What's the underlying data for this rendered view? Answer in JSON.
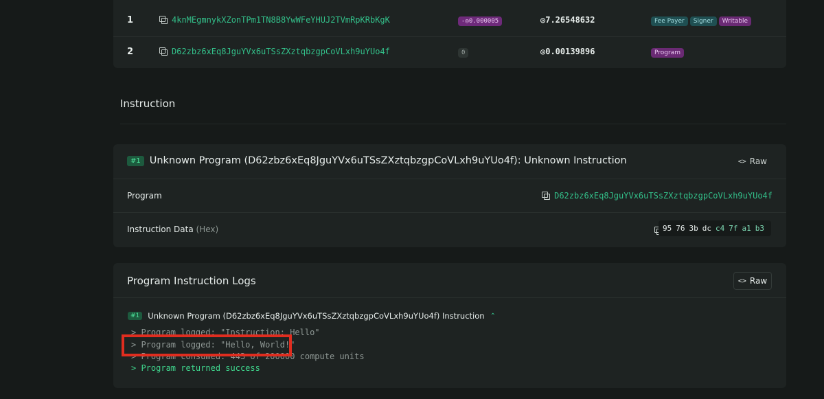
{
  "accounts": [
    {
      "index": "1",
      "address": "4knMEgmnykXZonTPm1TN8B8YwWFeYHUJ2TVmRpKRbKgK",
      "change": "-◎0.000005",
      "balance": "◎7.26548632",
      "tags": [
        "Fee Payer",
        "Signer",
        "Writable"
      ]
    },
    {
      "index": "2",
      "address": "D62zbz6xEq8JguYVx6uTSsZXztqbzgpCoVLxh9uYUo4f",
      "change": "0",
      "balance": "◎0.00139896",
      "tags": [
        "Program"
      ]
    }
  ],
  "instruction_section": {
    "title": "Instruction"
  },
  "instruction_card": {
    "badge": "#1",
    "title": "Unknown Program (D62zbz6xEq8JguYVx6uTSsZXztqbzgpCoVLxh9uYUo4f): Unknown Instruction",
    "raw_label": "Raw",
    "program_label": "Program",
    "program_value": "D62zbz6xEq8JguYVx6uTSsZXztqbzgpCoVLxh9uYUo4f",
    "data_label": "Instruction Data",
    "data_sub": "(Hex)",
    "hex_white": [
      "95",
      "76",
      "3b",
      "dc"
    ],
    "hex_green": [
      "c4",
      "7f",
      "a1",
      "b3"
    ]
  },
  "logs_card": {
    "title": "Program Instruction Logs",
    "raw_label": "Raw",
    "badge": "#1",
    "entry_title": "Unknown Program (D62zbz6xEq8JguYVx6uTSsZXztqbzgpCoVLxh9uYUo4f) Instruction",
    "lines": [
      "> Program logged: \"Instruction: Hello\"",
      "> Program logged: \"Hello, World!\"",
      "> Program consumed: 443 of 200000 compute units",
      "> Program returned success"
    ]
  },
  "colors": {
    "background": "#161a19",
    "card": "#1e2322",
    "accent_green": "#33c08a",
    "highlight_red": "#e02d1f"
  }
}
